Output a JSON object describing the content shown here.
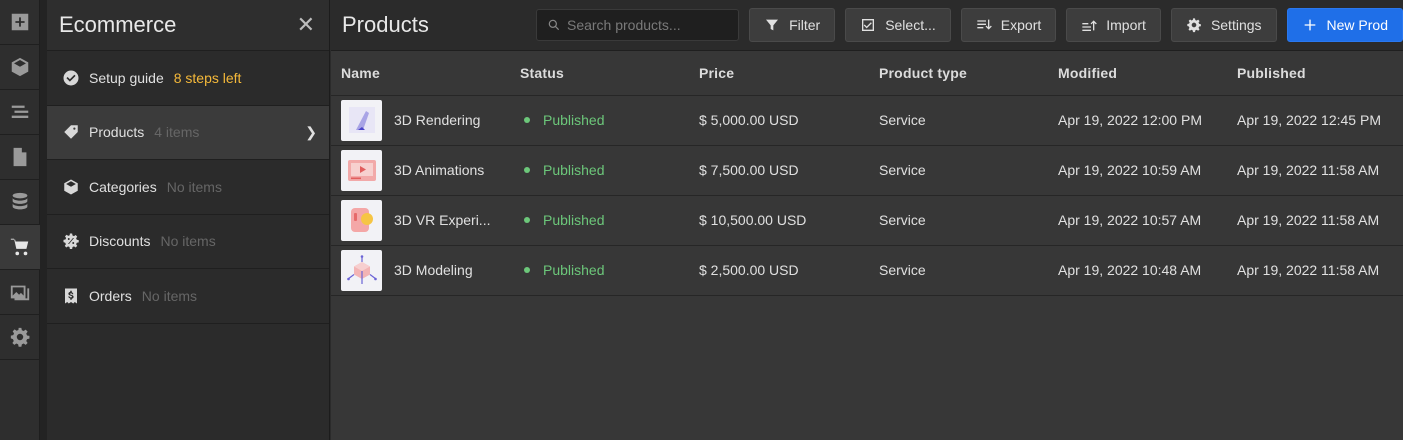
{
  "rail": {
    "icons": [
      "add-icon",
      "box-icon",
      "list-icon",
      "page-icon",
      "database-icon",
      "cart-icon",
      "images-icon",
      "gear-icon"
    ],
    "active_index": 5
  },
  "panel": {
    "title": "Ecommerce",
    "items": [
      {
        "icon": "check-circle-icon",
        "label": "Setup guide",
        "meta": "8 steps left"
      },
      {
        "icon": "tag-icon",
        "label": "Products",
        "meta": "4 items"
      },
      {
        "icon": "box-icon",
        "label": "Categories",
        "meta": "No items"
      },
      {
        "icon": "discount-icon",
        "label": "Discounts",
        "meta": "No items"
      },
      {
        "icon": "receipt-icon",
        "label": "Orders",
        "meta": "No items"
      }
    ]
  },
  "main": {
    "title": "Products",
    "search_placeholder": "Search products...",
    "buttons": {
      "filter": "Filter",
      "select": "Select...",
      "export": "Export",
      "import": "Import",
      "settings": "Settings",
      "new_product": "New Prod"
    },
    "columns": [
      "Name",
      "Status",
      "Price",
      "Product type",
      "Modified",
      "Published"
    ],
    "rows": [
      {
        "name": "3D Rendering",
        "status": "Published",
        "price": "$ 5,000.00 USD",
        "type": "Service",
        "modified": "Apr 19, 2022 12:00 PM",
        "published": "Apr 19, 2022 12:45 PM"
      },
      {
        "name": "3D Animations",
        "status": "Published",
        "price": "$ 7,500.00 USD",
        "type": "Service",
        "modified": "Apr 19, 2022 10:59 AM",
        "published": "Apr 19, 2022 11:58 AM"
      },
      {
        "name": "3D VR Experi...",
        "status": "Published",
        "price": "$ 10,500.00 USD",
        "type": "Service",
        "modified": "Apr 19, 2022 10:57 AM",
        "published": "Apr 19, 2022 11:58 AM"
      },
      {
        "name": "3D Modeling",
        "status": "Published",
        "price": "$ 2,500.00 USD",
        "type": "Service",
        "modified": "Apr 19, 2022 10:48 AM",
        "published": "Apr 19, 2022 11:58 AM"
      }
    ]
  },
  "colors": {
    "accent": "#1f6fe8",
    "published": "#6cc77a",
    "warning": "#f5b93a"
  }
}
